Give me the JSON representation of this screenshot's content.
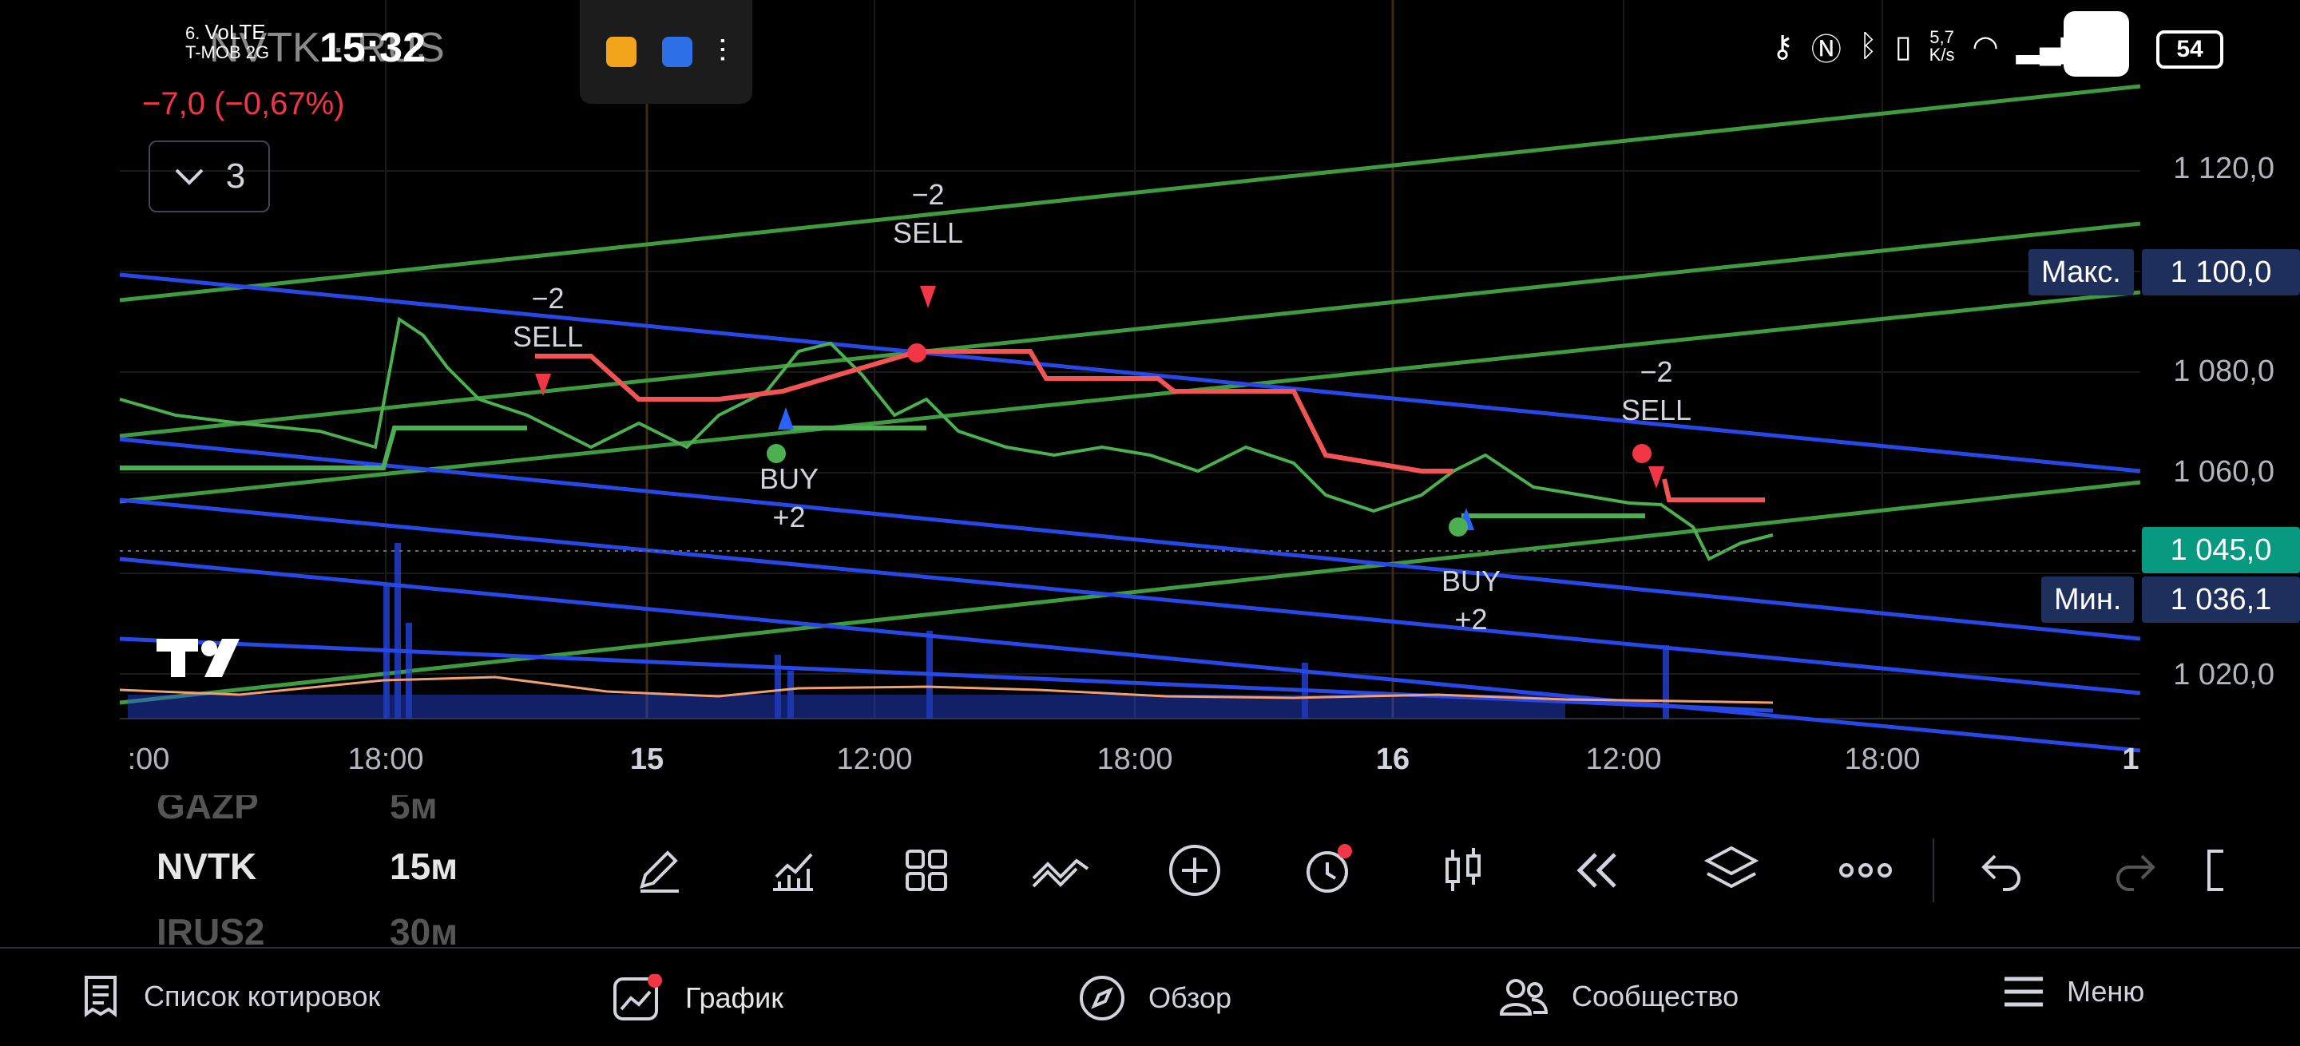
{
  "status_bar": {
    "time": "15:32",
    "carrier_line1": "6.",
    "carrier_net": "VoLTE",
    "carrier_line2": "T-MOB 2G",
    "net_speed_value": "5,7",
    "net_speed_unit": "K/s",
    "battery": "54"
  },
  "chart_header": {
    "symbol": "NVTK",
    "exchange": "RUS",
    "change": "−7,0 (−0,67%)",
    "indicators_count": "3"
  },
  "price_scale": {
    "labels": [
      "1 120,0",
      "1 080,0",
      "1 060,0",
      "1 020,0"
    ],
    "max_label": "Макс.",
    "max_value": "1 100,0",
    "current_value": "1 045,0",
    "min_label": "Мин.",
    "min_value": "1 036,1"
  },
  "time_scale": {
    "labels": [
      ":00",
      "18:00",
      "15",
      "12:00",
      "18:00",
      "16",
      "12:00",
      "18:00",
      "1"
    ]
  },
  "signals": [
    {
      "line1": "−2",
      "line2": "SELL"
    },
    {
      "line1": "BUY",
      "line2": "+2"
    },
    {
      "line1": "−2",
      "line2": "SELL"
    },
    {
      "line1": "BUY",
      "line2": "+2"
    },
    {
      "line1": "−2",
      "line2": "SELL"
    }
  ],
  "watchlist": {
    "prev": {
      "symbol": "GAZP",
      "timeframe": "5м"
    },
    "current": {
      "symbol": "NVTK",
      "timeframe": "15м"
    },
    "next": {
      "symbol": "IRUS2",
      "timeframe": "30м"
    }
  },
  "toolbar": {
    "icons": [
      "pencil-icon",
      "indicators-icon",
      "layout-icon",
      "drawings-icon",
      "plus-circle-icon",
      "alarm-icon",
      "candles-icon",
      "replay-icon",
      "layers-icon",
      "more-icon",
      "undo-icon",
      "redo-icon",
      "fullscreen-icon"
    ]
  },
  "bottom_nav": {
    "watchlist": "Список котировок",
    "chart": "График",
    "overview": "Обзор",
    "community": "Сообщество",
    "menu": "Меню"
  },
  "colors": {
    "up": "#4caf50",
    "down": "#f23645",
    "channel_blue": "#2747e6",
    "channel_green": "#3f9b3f",
    "accent_teal": "#089981"
  }
}
